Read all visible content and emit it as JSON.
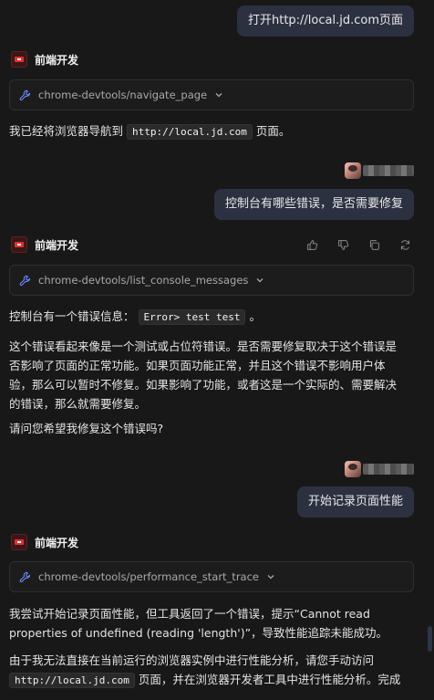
{
  "messages": {
    "user1": "打开http://local.jd.com页面",
    "bot_name": "前端开发",
    "tool1": "chrome-devtools/navigate_page",
    "reply1_pre": "我已经将浏览器导航到",
    "reply1_code": "http://local.jd.com",
    "reply1_post": "页面。",
    "user2": "控制台有哪些错误，是否需要修复",
    "tool2": "chrome-devtools/list_console_messages",
    "reply2_pre": "控制台有一个错误信息：",
    "reply2_code": "Error> test test",
    "reply2_post": "。",
    "reply2_p2_l1": "这个错误看起来像是一个测试或占位符错误。是否需要修复取决于这个错误是",
    "reply2_p2_l2": "否影响了页面的正常功能。如果页面功能正常，并且这个错误不影响用户体",
    "reply2_p2_l3": "验，那么可以暂时不修复。如果影响了功能，或者这是一个实际的、需要解决",
    "reply2_p2_l4": "的错误，那么就需要修复。",
    "reply2_p3": "请问您希望我修复这个错误吗?",
    "user3": "开始记录页面性能",
    "tool3": "chrome-devtools/performance_start_trace",
    "reply3_l1": "我尝试开始记录页面性能，但工具返回了一个错误，提示“Cannot read",
    "reply3_l2": "properties of undefined (reading 'length')”，导致性能追踪未能成功。",
    "reply3_p2_l1": "由于我无法直接在当前运行的浏览器实例中进行性能分析，请您手动访问",
    "reply3_p2_code": "http://local.jd.com",
    "reply3_p2_l2_post": "页面，并在浏览器开发者工具中进行性能分析。完成"
  },
  "icons": {
    "tool": "wrench-icon",
    "chevron": "chevron-down-icon",
    "actions": [
      "thumbs-up-icon",
      "thumbs-down-icon",
      "copy-icon",
      "regenerate-icon"
    ]
  },
  "colors": {
    "background": "#181818",
    "user_bubble": "#2b3140",
    "logo_red": "#e03131"
  }
}
